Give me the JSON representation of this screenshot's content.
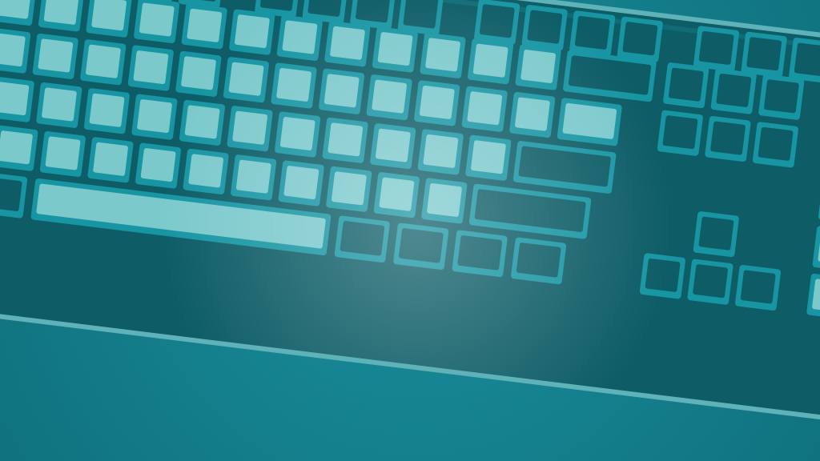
{
  "image": {
    "subject": "keyboard-illustration",
    "style": "flat-vector-grunge"
  },
  "colors": {
    "background": "#13808f",
    "background_dark": "#0f6f7c",
    "keyboard_body": "#0d5c66",
    "keyboard_edge": "#5fb3b8",
    "key_outline": "#1795a3",
    "key_fill_dark": "#0d5c66",
    "key_fill_light": "#7cc9cc",
    "highlight_glow": "#a8e3e3"
  },
  "keyboard": {
    "light_key_rows": 5,
    "function_key_groups": 4,
    "has_numpad": true,
    "has_arrow_cluster": true
  }
}
